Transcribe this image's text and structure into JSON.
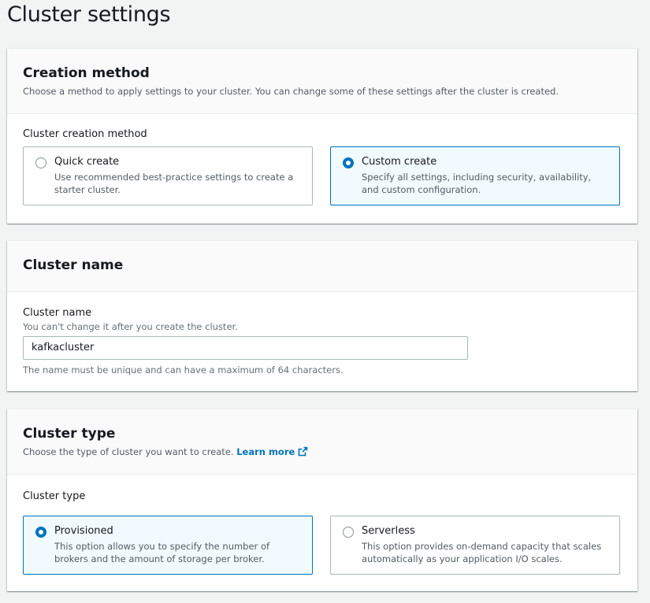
{
  "page": {
    "title": "Cluster settings"
  },
  "creation_method": {
    "title": "Creation method",
    "description": "Choose a method to apply settings to your cluster. You can change some of these settings after the cluster is created.",
    "field_label": "Cluster creation method",
    "options": [
      {
        "label": "Quick create",
        "description": "Use recommended best-practice settings to create a starter cluster.",
        "selected": false
      },
      {
        "label": "Custom create",
        "description": "Specify all settings, including security, availability, and custom configuration.",
        "selected": true
      }
    ]
  },
  "cluster_name": {
    "title": "Cluster name",
    "field_label": "Cluster name",
    "field_description": "You can't change it after you create the cluster.",
    "value": "kafkacluster",
    "constraint": "The name must be unique and can have a maximum of 64 characters."
  },
  "cluster_type": {
    "title": "Cluster type",
    "description": "Choose the type of cluster you want to create.",
    "learn_more": "Learn more",
    "field_label": "Cluster type",
    "options": [
      {
        "label": "Provisioned",
        "description": "This option allows you to specify the number of brokers and the amount of storage per broker.",
        "selected": true
      },
      {
        "label": "Serverless",
        "description": "This option provides on-demand capacity that scales automatically as your application I/O scales.",
        "selected": false
      }
    ]
  },
  "colors": {
    "accent": "#0073bb",
    "selected_bg": "#f1faff",
    "border": "#aab7b8"
  },
  "icons": {
    "learn_more": "external-link-icon"
  }
}
